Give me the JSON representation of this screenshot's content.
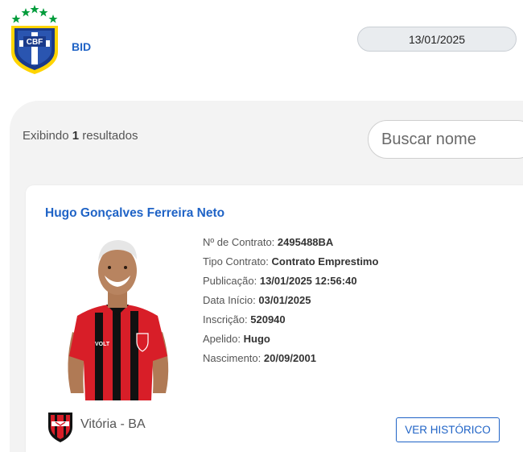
{
  "header": {
    "logo_text": "CBF",
    "app_label": "BID",
    "date": "13/01/2025"
  },
  "results": {
    "prefix": "Exibindo",
    "count": "1",
    "suffix": "resultados"
  },
  "search": {
    "placeholder": "Buscar nome"
  },
  "athlete": {
    "name": "Hugo Gonçalves Ferreira Neto",
    "fields": [
      {
        "label": "Nº de Contrato:",
        "value": "2495488BA"
      },
      {
        "label": "Tipo Contrato:",
        "value": "Contrato Emprestimo"
      },
      {
        "label": "Publicação:",
        "value": "13/01/2025 12:56:40"
      },
      {
        "label": "Data Início:",
        "value": "03/01/2025"
      },
      {
        "label": "Inscrição:",
        "value": "520940"
      },
      {
        "label": "Apelido:",
        "value": "Hugo"
      },
      {
        "label": "Nascimento:",
        "value": "20/09/2001"
      }
    ],
    "club": "Vitória - BA",
    "history_button": "VER HISTÓRICO",
    "shirt_sponsor": "VOLT"
  },
  "colors": {
    "accent": "#1f63c6",
    "cbf_green": "#009c3b",
    "cbf_yellow": "#ffd400",
    "cbf_blue": "#1a3a8a",
    "club_red": "#d81e28",
    "club_black": "#111111"
  }
}
